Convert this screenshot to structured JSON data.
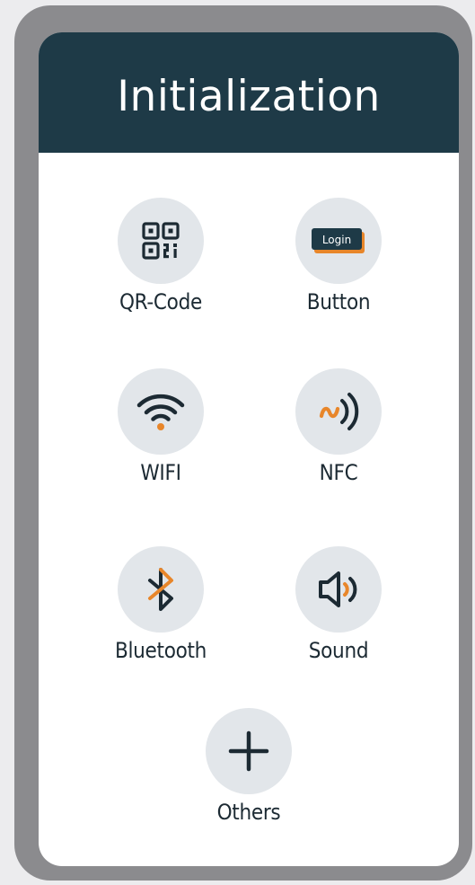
{
  "header": {
    "title": "Initialization"
  },
  "options": {
    "qr": {
      "label": "QR-Code",
      "icon": "qr-code-icon"
    },
    "button": {
      "label": "Button",
      "icon": "login-button-icon",
      "icon_text": "Login"
    },
    "wifi": {
      "label": "WIFI",
      "icon": "wifi-icon"
    },
    "nfc": {
      "label": "NFC",
      "icon": "nfc-icon"
    },
    "bluetooth": {
      "label": "Bluetooth",
      "icon": "bluetooth-icon"
    },
    "sound": {
      "label": "Sound",
      "icon": "sound-icon"
    },
    "others": {
      "label": "Others",
      "icon": "plus-icon"
    }
  },
  "colors": {
    "header_bg": "#1e3a47",
    "accent_orange": "#e8862a",
    "icon_dark": "#1c2a33",
    "circle_bg": "#e2e6ea",
    "frame": "#8b8b8e"
  }
}
